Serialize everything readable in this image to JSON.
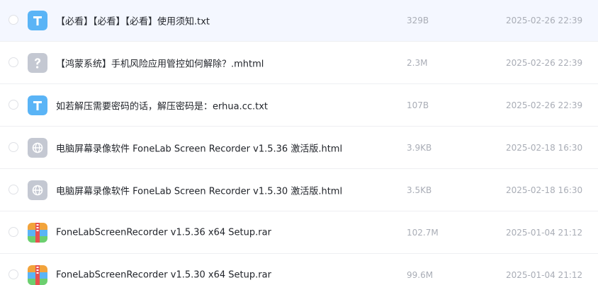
{
  "files": [
    {
      "name": "【必看】【必看】【必看】使用须知.txt",
      "size": "329B",
      "date": "2025-02-26 22:39",
      "icon": "text-file-icon",
      "color": "#5ab4f6"
    },
    {
      "name": "【鸿蒙系统】手机风险应用管控如何解除？.mhtml",
      "size": "2.3M",
      "date": "2025-02-26 22:39",
      "icon": "unknown-file-icon",
      "color": "#c4c8d2"
    },
    {
      "name": "如若解压需要密码的话，解压密码是：erhua.cc.txt",
      "size": "107B",
      "date": "2025-02-26 22:39",
      "icon": "text-file-icon",
      "color": "#5ab4f6"
    },
    {
      "name": "电脑屏幕录像软件 FoneLab Screen Recorder v1.5.36 激活版.html",
      "size": "3.9KB",
      "date": "2025-02-18 16:30",
      "icon": "web-file-icon",
      "color": "#c4c8d2"
    },
    {
      "name": "电脑屏幕录像软件 FoneLab Screen Recorder v1.5.30 激活版.html",
      "size": "3.5KB",
      "date": "2025-02-18 16:30",
      "icon": "web-file-icon",
      "color": "#c4c8d2"
    },
    {
      "name": "FoneLabScreenRecorder v1.5.36 x64 Setup.rar",
      "size": "102.7M",
      "date": "2025-01-04 21:12",
      "icon": "archive-file-icon",
      "color": "#f2a33b"
    },
    {
      "name": "FoneLabScreenRecorder v1.5.30 x64 Setup.rar",
      "size": "99.6M",
      "date": "2025-01-04 21:12",
      "icon": "archive-file-icon",
      "color": "#f2a33b"
    }
  ]
}
